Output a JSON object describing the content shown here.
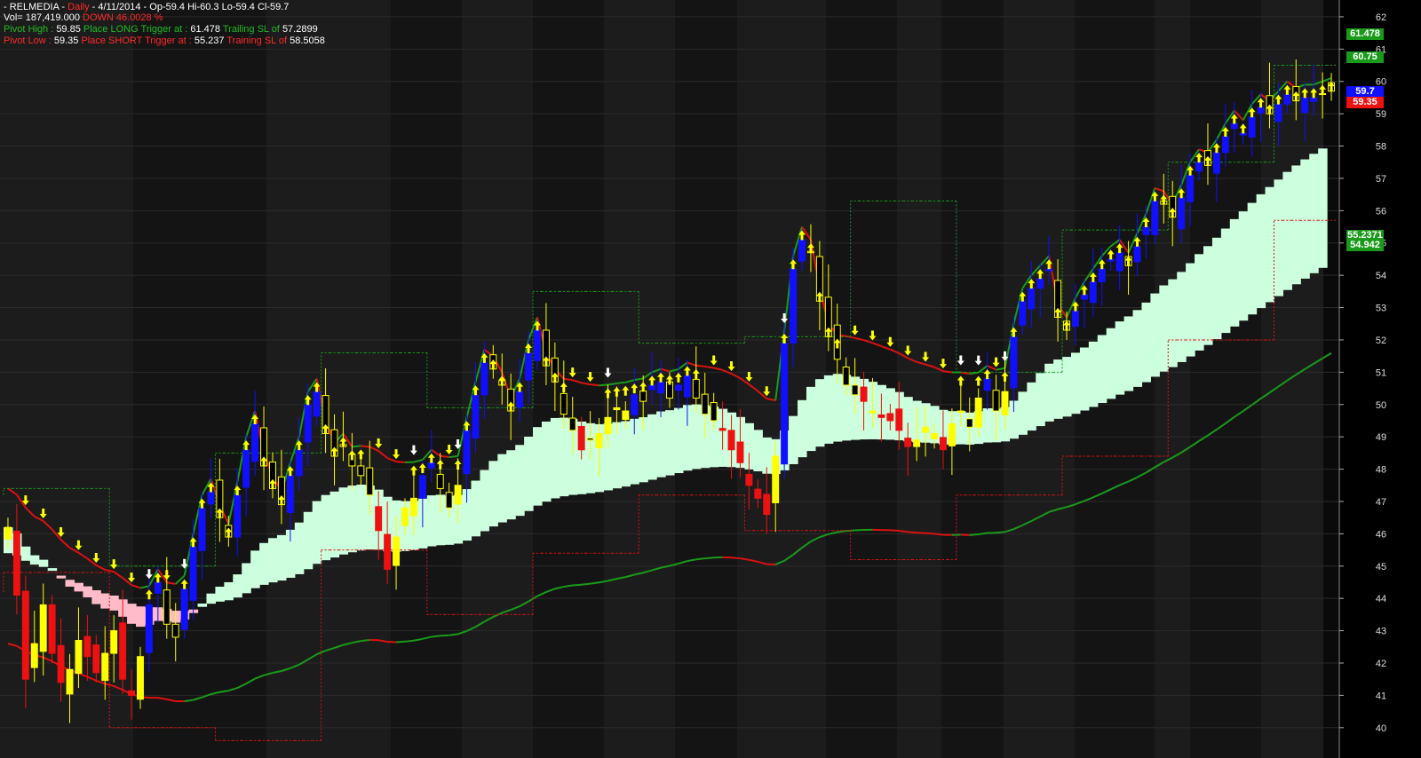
{
  "header": {
    "line1": {
      "symbol": "- RELMEDIA -",
      "period": "Daily",
      "rest": "- 4/11/2014 - Op-59.4  Hi-60.3  Lo-59.4  Cl-59.7"
    },
    "line2": {
      "vol": "Vol= 187,419.000",
      "direction": "DOWN 46.0028 %"
    },
    "line3": {
      "l1": "Pivot High :",
      "v1": "59.85",
      "l2": "Place LONG   Trigger at :",
      "v2": "61.478",
      "l3": "Trailing SL of",
      "v3": "57.2899"
    },
    "line4": {
      "l1": "Pivot  Low :",
      "v1": "59.35",
      "l2": "Place SHORT Trigger at :",
      "v2": "55.237",
      "l3": "Training SL of",
      "v3": "58.5058"
    }
  },
  "price_tags": [
    {
      "text": "61.478",
      "value": 61.478,
      "color": "#1a9a1a"
    },
    {
      "text": "60.75",
      "value": 60.75,
      "color": "#1a9a1a"
    },
    {
      "text": "59.7",
      "value": 59.7,
      "color": "#1010ff"
    },
    {
      "text": "59.35",
      "value": 59.35,
      "color": "#ee1111"
    },
    {
      "text": "55.2371",
      "value": 55.2371,
      "color": "#1a9a1a"
    },
    {
      "text": "54.942",
      "value": 54.942,
      "color": "#1a9a1a"
    }
  ],
  "chart_data": {
    "type": "candlestick",
    "ylim": [
      39.5,
      62.3
    ],
    "yticks": [
      40,
      41,
      42,
      43,
      44,
      45,
      46,
      47,
      48,
      49,
      50,
      51,
      52,
      53,
      54,
      55,
      56,
      57,
      58,
      59,
      60,
      61,
      62
    ],
    "grid": true,
    "bar_count": 205,
    "last": {
      "date": "4/11/2014",
      "open": 59.4,
      "high": 60.3,
      "low": 59.4,
      "close": 59.7
    },
    "closes": [
      46.2,
      44.1,
      41.5,
      42.6,
      43.8,
      42.3,
      41.4,
      41.8,
      42.7,
      42.2,
      41.7,
      42.3,
      43.0,
      41.5,
      41.0,
      42.2,
      43.8,
      44.5,
      43.2,
      42.8,
      44.3,
      45.6,
      46.8,
      47.3,
      46.5,
      45.9,
      47.2,
      48.6,
      49.4,
      48.1,
      47.4,
      46.9,
      47.8,
      48.6,
      50.0,
      50.4,
      49.1,
      48.4,
      48.7,
      48.1,
      47.8,
      47.2,
      46.1,
      44.9,
      45.9,
      46.8,
      47.1,
      47.8,
      48.2,
      47.4,
      46.8,
      47.5,
      49.2,
      50.3,
      51.3,
      51.1,
      50.6,
      49.8,
      50.4,
      51.6,
      52.3,
      51.2,
      50.7,
      49.7,
      49.2,
      48.6,
      48.9,
      49.1,
      49.6,
      49.9,
      49.8,
      50.3,
      50.1,
      50.6,
      50.7,
      50.2,
      50.6,
      50.9,
      50.2,
      49.7,
      49.5,
      49.2,
      48.6,
      48.2,
      47.5,
      47.1,
      46.6,
      48.4,
      51.9,
      54.2,
      55.1,
      54.7,
      53.2,
      52.1,
      51.4,
      50.6,
      50.3,
      50.1,
      49.8,
      49.6,
      49.5,
      49.2,
      48.7,
      48.9,
      49.3,
      49.1,
      48.6,
      49.4,
      49.8,
      49.3,
      50.2,
      50.8,
      49.8,
      50.4,
      52.1,
      53.2,
      53.6,
      53.9,
      54.2,
      52.7,
      52.3,
      52.9,
      53.4,
      53.8,
      54.2,
      54.5,
      54.7,
      54.3,
      54.9,
      55.5,
      56.3,
      56.2,
      55.8,
      56.4,
      57.1,
      57.5,
      57.4,
      57.8,
      58.3,
      58.7,
      58.4,
      58.9,
      59.2,
      59.0,
      59.3,
      59.6,
      59.4,
      59.5,
      59.5,
      59.6,
      59.7
    ],
    "series": [
      {
        "name": "",
        "color": "#1a9a1a",
        "alt_color": "#dd1111",
        "kind": "upper_band"
      },
      {
        "name": "",
        "color": "#1a9a1a",
        "alt_color": "#dd1111",
        "kind": "lower_band"
      },
      {
        "name": "",
        "color": "#ccffdd",
        "alt_color": "#ffbbc8",
        "kind": "cloud"
      }
    ],
    "candle_colors": {
      "up": "#1010ff",
      "down": "#ee1111",
      "neutral": "#ffff00",
      "inside": "#000000"
    },
    "signals": {
      "buy_color": "#ffff00",
      "sell_color": "#ffff00",
      "entry_color": "#ffffff"
    }
  }
}
